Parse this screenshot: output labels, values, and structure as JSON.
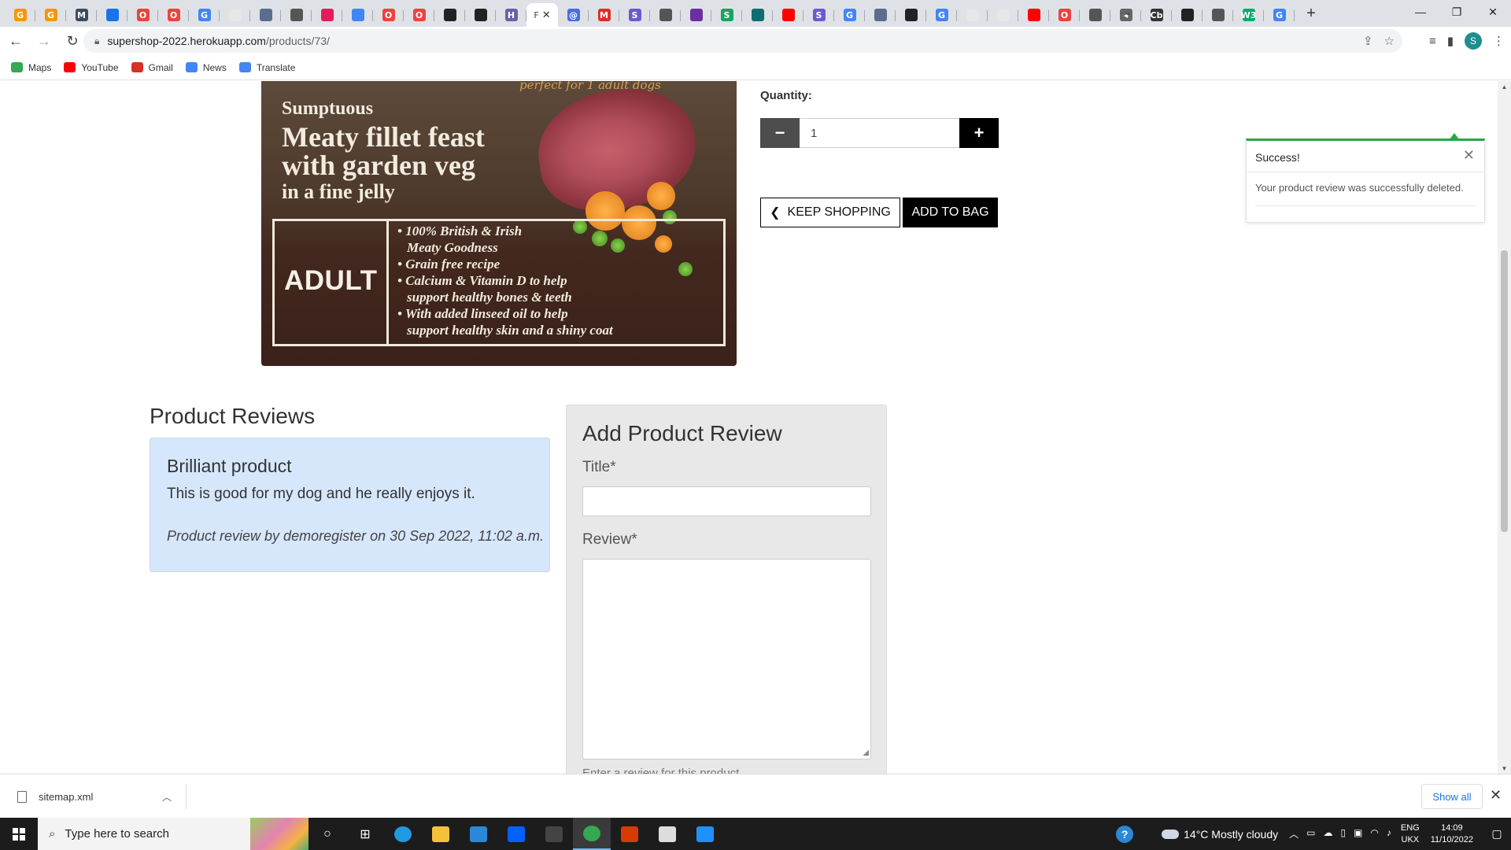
{
  "browser": {
    "tabs": [
      {
        "icon": "google-icon",
        "letter": "G",
        "color": "#f29900"
      },
      {
        "icon": "google-icon",
        "letter": "G",
        "color": "#f29900"
      },
      {
        "icon": "code-institute-icon",
        "letter": "M",
        "color": "#3c4a5e"
      },
      {
        "icon": "globe-icon",
        "letter": "",
        "color": "#1a73e8"
      },
      {
        "icon": "opera-icon",
        "letter": "O",
        "color": "#e8453c"
      },
      {
        "icon": "opera-icon",
        "letter": "O",
        "color": "#e8453c"
      },
      {
        "icon": "google-icon",
        "letter": "G",
        "color": "#4285f4"
      },
      {
        "icon": "blank-page-icon",
        "letter": "",
        "color": "#e6e6e6"
      },
      {
        "icon": "docs-icon",
        "letter": "",
        "color": "#5a6d8c"
      },
      {
        "icon": "circle-tab-icon",
        "letter": "",
        "color": "#555555"
      },
      {
        "icon": "slack-icon",
        "letter": "",
        "color": "#e01e5a"
      },
      {
        "icon": "google-docs-icon",
        "letter": "",
        "color": "#4285f4"
      },
      {
        "icon": "opera-icon",
        "letter": "O",
        "color": "#e8453c"
      },
      {
        "icon": "opera-icon",
        "letter": "O",
        "color": "#e8453c"
      },
      {
        "icon": "github-icon",
        "letter": "",
        "color": "#222222"
      },
      {
        "icon": "github-icon",
        "letter": "",
        "color": "#222222"
      },
      {
        "icon": "heroku-icon",
        "letter": "H",
        "color": "#6762a6"
      }
    ],
    "active_tab": {
      "label": "F",
      "close": "✕"
    },
    "tabs_after": [
      {
        "icon": "at-sign-icon",
        "letter": "@",
        "color": "#4a6ee0"
      },
      {
        "icon": "gmail-icon",
        "letter": "M",
        "color": "#d93025"
      },
      {
        "icon": "s-app-icon",
        "letter": "S",
        "color": "#6a5acd"
      },
      {
        "icon": "circle-tab-icon",
        "letter": "",
        "color": "#555555"
      },
      {
        "icon": "mail-icon",
        "letter": "",
        "color": "#6b2fa0"
      },
      {
        "icon": "s-green-icon",
        "letter": "S",
        "color": "#1aa260"
      },
      {
        "icon": "teal-circle-icon",
        "letter": "",
        "color": "#0f6e6e"
      },
      {
        "icon": "youtube-icon",
        "letter": "",
        "color": "#ff0000"
      },
      {
        "icon": "s-app-icon",
        "letter": "S",
        "color": "#6a5acd"
      },
      {
        "icon": "google-icon",
        "letter": "G",
        "color": "#4285f4"
      },
      {
        "icon": "docs-icon",
        "letter": "",
        "color": "#5a6d8c"
      },
      {
        "icon": "github-icon",
        "letter": "",
        "color": "#222222"
      },
      {
        "icon": "google-icon",
        "letter": "G",
        "color": "#4285f4"
      },
      {
        "icon": "blank-page-icon",
        "letter": "",
        "color": "#e6e6e6"
      },
      {
        "icon": "blank-page-icon",
        "letter": "",
        "color": "#e6e6e6"
      },
      {
        "icon": "youtube-icon",
        "letter": "",
        "color": "#ff0000"
      },
      {
        "icon": "opera-icon",
        "letter": "O",
        "color": "#e8453c"
      },
      {
        "icon": "circle-tab-icon",
        "letter": "",
        "color": "#555555"
      },
      {
        "icon": "speaker-icon",
        "letter": "◂",
        "color": "#666666"
      },
      {
        "icon": "cb-icon",
        "letter": "Cb",
        "color": "#333333"
      },
      {
        "icon": "rocket-icon",
        "letter": "",
        "color": "#222222"
      },
      {
        "icon": "circle-tab-icon",
        "letter": "",
        "color": "#555555"
      },
      {
        "icon": "w3schools-icon",
        "letter": "W3",
        "color": "#04aa6d"
      },
      {
        "icon": "google-icon",
        "letter": "G",
        "color": "#4285f4"
      }
    ],
    "url_host": "supershop-2022.herokuapp.com",
    "url_path": "/products/73/",
    "bookmarks": [
      {
        "icon": "maps-icon",
        "label": "Maps",
        "color": "#34a853"
      },
      {
        "icon": "youtube-icon",
        "label": "YouTube",
        "color": "#ff0000"
      },
      {
        "icon": "gmail-icon",
        "label": "Gmail",
        "color": "#d93025"
      },
      {
        "icon": "news-icon",
        "label": "News",
        "color": "#4285f4"
      },
      {
        "icon": "translate-icon",
        "label": "Translate",
        "color": "#4285f4"
      }
    ],
    "profile_initial": "S"
  },
  "product": {
    "image_tag": "perfect for 1 adult dogs",
    "headline_line1": "Sumptuous",
    "headline_line2": "Meaty fillet feast",
    "headline_line3": "with garden veg",
    "headline_line4": "in a fine jelly",
    "badge": "ADULT",
    "bullets": [
      {
        "line1": "• 100% British & Irish",
        "line2": "Meaty Goodness"
      },
      {
        "line1": "• Grain free recipe",
        "line2": ""
      },
      {
        "line1": "• Calcium & Vitamin D to help",
        "line2": "support healthy bones & teeth"
      },
      {
        "line1": "• With added linseed oil to help",
        "line2": "support healthy skin and a shiny coat"
      }
    ],
    "quantity_label": "Quantity:",
    "quantity_value": "1",
    "minus": "−",
    "plus": "+",
    "keep_shopping": "KEEP SHOPPING",
    "add_to_bag": "ADD TO BAG"
  },
  "toast": {
    "title": "Success!",
    "message": "Your product review was successfully deleted.",
    "close": "✕",
    "accent": "#28a745"
  },
  "reviews": {
    "heading": "Product Reviews",
    "items": [
      {
        "title": "Brilliant product",
        "body": "This is good for my dog and he really enjoys it.",
        "meta": "Product review by demoregister on 30 Sep 2022, 11:02 a.m."
      }
    ]
  },
  "add_review": {
    "heading": "Add Product Review",
    "title_label": "Title*",
    "title_value": "",
    "review_label": "Review*",
    "review_value": "",
    "help_text": "Enter a review for this product"
  },
  "downloads": {
    "file_name": "sitemap.xml",
    "show_all": "Show all"
  },
  "taskbar": {
    "search_placeholder": "Type here to search",
    "weather": "14°C  Mostly cloudy",
    "lang_line1": "ENG",
    "lang_line2": "UKX",
    "time": "14:09",
    "date": "11/10/2022",
    "apps": [
      {
        "icon": "task-view-icon",
        "glyph": "○",
        "color": ""
      },
      {
        "icon": "timeline-icon",
        "glyph": "⊞",
        "color": ""
      },
      {
        "icon": "edge-icon",
        "glyph": "",
        "color": "#1f9ae0"
      },
      {
        "icon": "file-explorer-icon",
        "glyph": "",
        "color": "#f3c13a"
      },
      {
        "icon": "mail-icon",
        "glyph": "",
        "color": "#2b88d8"
      },
      {
        "icon": "dropbox-icon",
        "glyph": "",
        "color": "#0061fe"
      },
      {
        "icon": "code-icon",
        "glyph": "",
        "color": "#444444"
      },
      {
        "icon": "chrome-icon",
        "glyph": "",
        "color": "#34a853",
        "active": true
      },
      {
        "icon": "office-icon",
        "glyph": "",
        "color": "#d83b01"
      },
      {
        "icon": "paint-icon",
        "glyph": "",
        "color": "#dddddd"
      },
      {
        "icon": "photos-icon",
        "glyph": "",
        "color": "#1e90ff"
      }
    ]
  }
}
